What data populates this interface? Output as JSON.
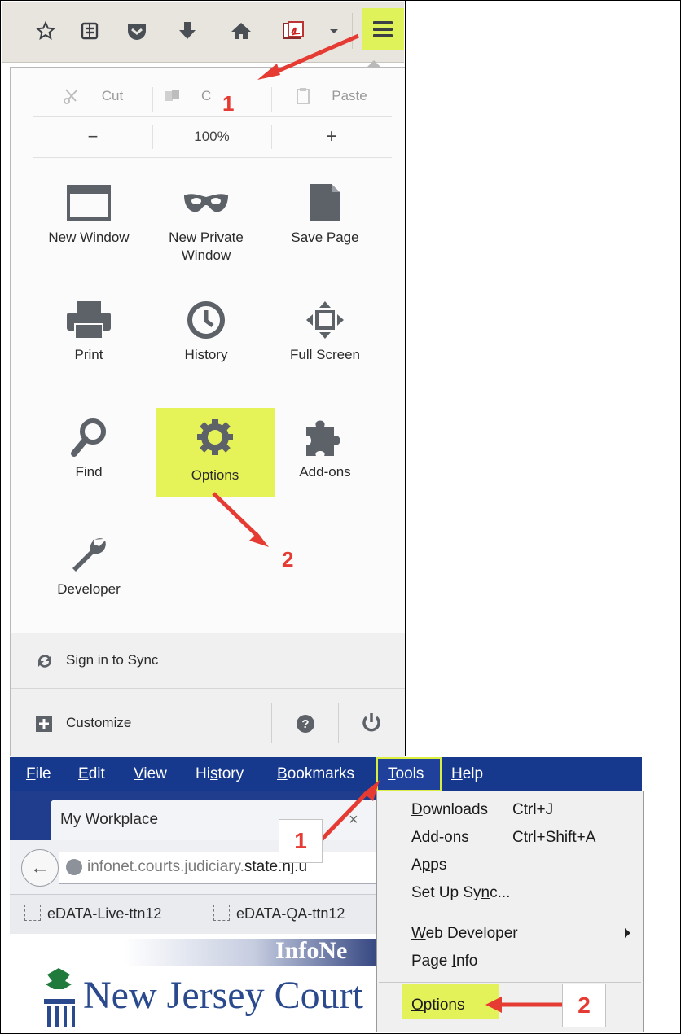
{
  "toolbar": {
    "icons": [
      "bookmark-star-icon",
      "reading-list-icon",
      "pocket-icon",
      "download-icon",
      "home-icon",
      "pdf-icon",
      "dropdown-icon",
      "hamburger-menu-icon"
    ]
  },
  "menu_panel": {
    "edit": {
      "cut": "Cut",
      "copy": "C",
      "paste": "Paste"
    },
    "zoom": {
      "minus": "−",
      "level": "100%",
      "plus": "+"
    },
    "items": [
      {
        "label": "New Window",
        "icon": "window-icon"
      },
      {
        "label": "New Private\nWindow",
        "icon": "mask-icon"
      },
      {
        "label": "Save Page",
        "icon": "page-icon"
      },
      {
        "label": "Print",
        "icon": "printer-icon"
      },
      {
        "label": "History",
        "icon": "clock-icon"
      },
      {
        "label": "Full Screen",
        "icon": "fullscreen-icon"
      },
      {
        "label": "Find",
        "icon": "magnifier-icon"
      },
      {
        "label": "Options",
        "icon": "gear-icon"
      },
      {
        "label": "Add-ons",
        "icon": "puzzle-icon"
      },
      {
        "label": "Developer",
        "icon": "wrench-icon"
      }
    ],
    "sync": "Sign in to Sync",
    "customize": "Customize",
    "help_icon": "help-icon",
    "power_icon": "power-icon"
  },
  "annotations_top": {
    "step1": "1",
    "step2": "2"
  },
  "menubar": {
    "items": [
      {
        "label": "File",
        "key": "F",
        "rest": "ile"
      },
      {
        "label": "Edit",
        "key": "E",
        "rest": "dit"
      },
      {
        "label": "View",
        "key": "V",
        "rest": "iew"
      },
      {
        "label": "History",
        "pre": "Hi",
        "key": "s",
        "rest": "tory"
      },
      {
        "label": "Bookmarks",
        "key": "B",
        "rest": "ookmarks"
      },
      {
        "label": "Tools",
        "key": "T",
        "rest": "ools"
      },
      {
        "label": "Help",
        "key": "H",
        "rest": "elp"
      }
    ]
  },
  "browser": {
    "tab_title": "My Workplace",
    "url_prefix": "infonet.courts.judiciary.",
    "url_domain": "state.nj.u",
    "bookmarks": [
      "eDATA-Live-ttn12",
      "eDATA-QA-ttn12"
    ],
    "banner": "InfoNe",
    "site_title": "New Jersey Court"
  },
  "tools_menu": {
    "downloads": {
      "key": "D",
      "rest": "ownloads",
      "shortcut": "Ctrl+J"
    },
    "addons": {
      "key": "A",
      "rest": "dd-ons",
      "shortcut": "Ctrl+Shift+A"
    },
    "apps": {
      "pre": "A",
      "key": "p",
      "rest": "ps"
    },
    "sync": {
      "pre": "Set Up Sy",
      "key": "n",
      "rest": "c..."
    },
    "webdev": {
      "key": "W",
      "rest": "eb Developer"
    },
    "pageinfo": {
      "pre": "Page ",
      "key": "I",
      "rest": "nfo"
    },
    "options": {
      "key": "O",
      "rest": "ptions"
    }
  },
  "annotations_bottom": {
    "step1": "1",
    "step2": "2"
  },
  "colors": {
    "highlight": "#e4f25a",
    "arrow": "#e53b32",
    "menubar": "#16388d"
  }
}
